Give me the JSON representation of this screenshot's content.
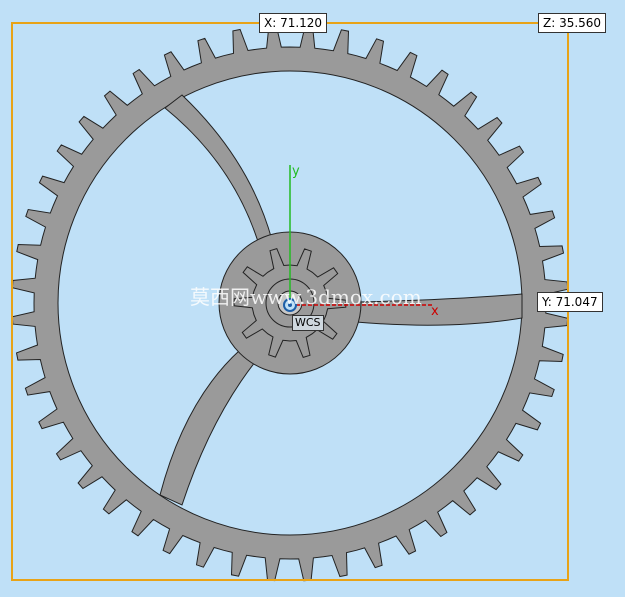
{
  "dimensions": {
    "x_label": "X: 71.120",
    "y_label": "Y: 71.047",
    "z_label": "Z: 35.560"
  },
  "triad": {
    "x_axis_label": "x",
    "y_axis_label": "y",
    "wcs_label": "WCS"
  },
  "watermark": "莫西网www.3dmox.com",
  "colors": {
    "background": "#bfe0f7",
    "bbox": "#e8a317",
    "gear_fill": "#9a9a9a",
    "x_axis": "#cc0000",
    "y_axis": "#22bb22"
  },
  "gear": {
    "outer_teeth": 48,
    "pinion_teeth": 10,
    "spokes": 3
  }
}
